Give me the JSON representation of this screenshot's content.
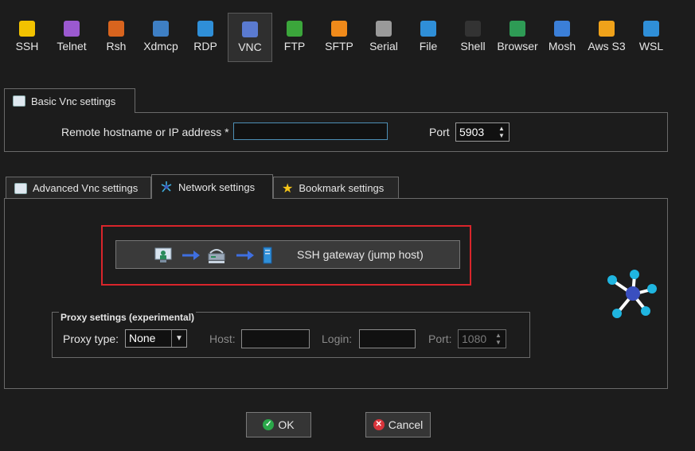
{
  "toolbar": {
    "items": [
      {
        "label": "SSH",
        "icon": "ssh-key-icon",
        "color": "#f2c200"
      },
      {
        "label": "Telnet",
        "icon": "telnet-icon",
        "color": "#9b59d0"
      },
      {
        "label": "Rsh",
        "icon": "rsh-icon",
        "color": "#d8641e"
      },
      {
        "label": "Xdmcp",
        "icon": "xdmcp-icon",
        "color": "#3e7fc4"
      },
      {
        "label": "RDP",
        "icon": "rdp-monitor-icon",
        "color": "#2f8fd8"
      },
      {
        "label": "VNC",
        "icon": "vnc-icon",
        "color": "#5a7ad0"
      },
      {
        "label": "FTP",
        "icon": "ftp-globe-icon",
        "color": "#3ba63b"
      },
      {
        "label": "SFTP",
        "icon": "sftp-globe-icon",
        "color": "#f08a1a"
      },
      {
        "label": "Serial",
        "icon": "serial-plug-icon",
        "color": "#9a9a9a"
      },
      {
        "label": "File",
        "icon": "file-monitor-icon",
        "color": "#2f8fd8"
      },
      {
        "label": "Shell",
        "icon": "shell-terminal-icon",
        "color": "#333333"
      },
      {
        "label": "Browser",
        "icon": "browser-globe-icon",
        "color": "#2e9b55"
      },
      {
        "label": "Mosh",
        "icon": "mosh-satellite-icon",
        "color": "#3b7fd8"
      },
      {
        "label": "Aws S3",
        "icon": "aws-s3-cubes-icon",
        "color": "#f0a21a"
      },
      {
        "label": "WSL",
        "icon": "wsl-windows-icon",
        "color": "#2f8fd8"
      }
    ],
    "active": "VNC"
  },
  "basic_tab": {
    "label": "Basic Vnc settings",
    "hostname_label": "Remote hostname or IP address *",
    "hostname_value": "",
    "port_label": "Port",
    "port_value": "5903"
  },
  "lower_tabs": [
    {
      "label": "Advanced Vnc settings"
    },
    {
      "label": "Network settings"
    },
    {
      "label": "Bookmark settings"
    }
  ],
  "network": {
    "gateway_label": "SSH gateway (jump host)",
    "proxy": {
      "legend": "Proxy settings (experimental)",
      "type_label": "Proxy type:",
      "type_value": "None",
      "host_label": "Host:",
      "host_value": "",
      "login_label": "Login:",
      "login_value": "",
      "port_label": "Port:",
      "port_value": "1080"
    }
  },
  "buttons": {
    "ok": "OK",
    "cancel": "Cancel"
  }
}
